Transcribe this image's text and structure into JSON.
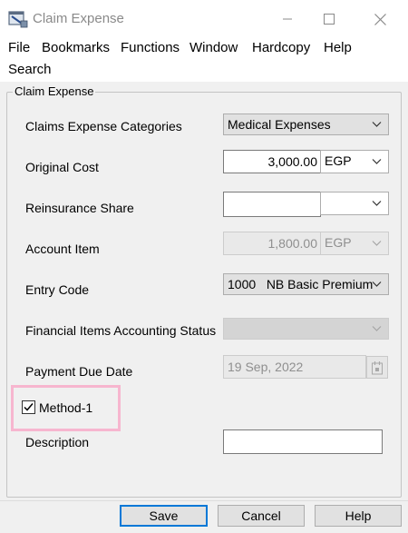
{
  "window": {
    "title": "Claim Expense"
  },
  "menu": {
    "file": "File",
    "bookmarks": "Bookmarks",
    "functions": "Functions",
    "window": "Window",
    "hardcopy": "Hardcopy",
    "help": "Help",
    "search": "Search"
  },
  "group": {
    "title": "Claim Expense"
  },
  "form": {
    "categories": {
      "label": "Claims Expense Categories",
      "value": "Medical Expenses"
    },
    "original_cost": {
      "label": "Original Cost",
      "value": "3,000.00",
      "currency": "EGP"
    },
    "reinsurance_share": {
      "label": "Reinsurance Share",
      "value": "",
      "currency": ""
    },
    "account_item": {
      "label": "Account Item",
      "value": "1,800.00",
      "currency": "EGP"
    },
    "entry_code": {
      "label": "Entry Code",
      "value": "1000   NB Basic Premium"
    },
    "accounting_status": {
      "label": "Financial Items Accounting Status",
      "value": ""
    },
    "payment_due_date": {
      "label": "Payment Due Date",
      "value": "19 Sep, 2022"
    },
    "method": {
      "label": "Method-1",
      "checked": true
    },
    "description": {
      "label": "Description",
      "value": ""
    }
  },
  "buttons": {
    "save": "Save",
    "cancel": "Cancel",
    "help": "Help"
  },
  "colors": {
    "highlight": "#f7b6cf",
    "default_button_border": "#0078d7"
  }
}
